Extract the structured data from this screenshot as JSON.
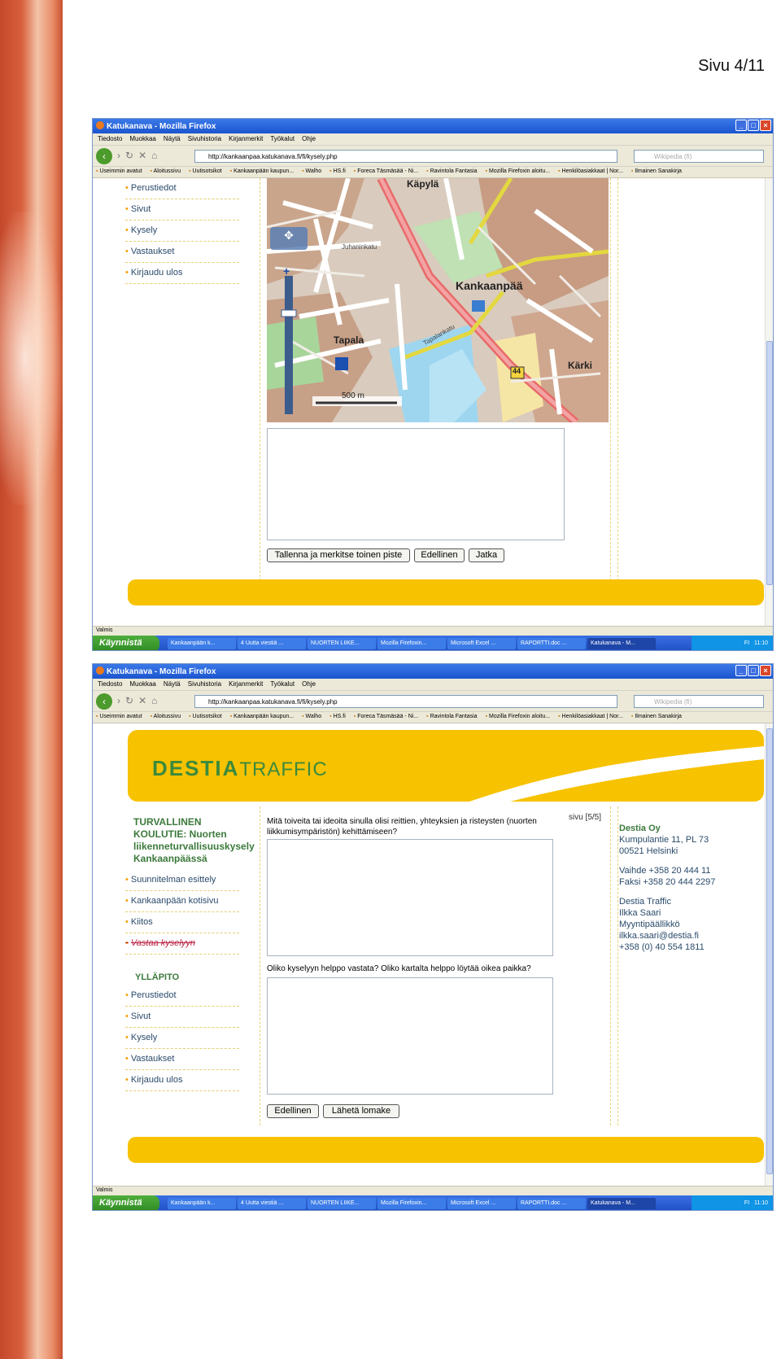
{
  "page": {
    "number_label": "Sivu 4/11"
  },
  "browser": {
    "title": "Katukanava - Mozilla Firefox",
    "menu": [
      "Tiedosto",
      "Muokkaa",
      "Näytä",
      "Sivuhistoria",
      "Kirjanmerkit",
      "Työkalut",
      "Ohje"
    ],
    "url": "http://kankaanpaa.katukanava.fi/fi/kysely.php",
    "search_placeholder": "Wikipedia (fi)",
    "bookmarks": [
      "Useimmin avatut",
      "Aloitussivu",
      "Uutisotsikot",
      "Kankaanpään kaupun...",
      "Walho",
      "HS.fi",
      "Foreca Täsmäsää - Ni...",
      "Ravintola Fantasia",
      "Mozilla Firefoxin aloitu...",
      "Henkilöasiakkaat | Nor...",
      "Ilmainen Sanakirja"
    ],
    "status": "Valmis"
  },
  "taskbar": {
    "start": "Käynnistä",
    "tasks": [
      "Kankaanpään k...",
      "4 Uutta viestiä ...",
      "NUORTEN LIIKE...",
      "Mozilla Firefoxin...",
      "Microsoft Excel ...",
      "RAPORTTI.doc ...",
      "Katukanava - M..."
    ],
    "lang": "FI",
    "time": "11:10"
  },
  "shot1": {
    "nav": [
      "Perustiedot",
      "Sivut",
      "Kysely",
      "Vastaukset",
      "Kirjaudu ulos"
    ],
    "map_labels": {
      "kapyla": "Käpylä",
      "kankaanpaa": "Kankaanpää",
      "tapala": "Tapala",
      "karki": "Kärki",
      "scale": "500 m",
      "road44": "44",
      "juhanin": "Juhaninkatu",
      "tapalan": "Tapalankatu"
    },
    "buttons": {
      "save_another": "Tallenna ja merkitse toinen piste",
      "previous": "Edellinen",
      "continue": "Jatka"
    }
  },
  "shot2": {
    "logo_bold": "DESTIA",
    "logo_light": "TRAFFIC",
    "survey_title": "TURVALLINEN KOULUTIE: Nuorten liikenneturvallisuuskysely Kankaanpäässä",
    "nav_main": [
      "Suunnitelman esittely",
      "Kankaanpään kotisivu",
      "Kiitos",
      "Vastaa kyselyyn"
    ],
    "admin_heading": "YLLÄPITO",
    "nav_admin": [
      "Perustiedot",
      "Sivut",
      "Kysely",
      "Vastaukset",
      "Kirjaudu ulos"
    ],
    "page_indicator": "sivu [5/5]",
    "question1": "Mitä toiveita tai ideoita sinulla olisi reittien, yhteyksien ja risteysten (nuorten liikkumisympäristön) kehittämiseen?",
    "question2": "Oliko kyselyyn helppo vastata? Oliko kartalta helppo löytää oikea paikka?",
    "buttons": {
      "previous": "Edellinen",
      "submit": "Lähetä lomake"
    },
    "contact": {
      "company": "Destia Oy",
      "address1": "Kumpulantie 11, PL 73",
      "address2": "00521 Helsinki",
      "switchboard": "Vaihde +358 20 444 11",
      "fax": "Faksi +358 20 444 2297",
      "unit": "Destia Traffic",
      "name": "Ilkka Saari",
      "role": "Myyntipäällikkö",
      "email": "ilkka.saari@destia.fi",
      "phone": "+358 (0) 40 554 1811"
    }
  },
  "colors": {
    "brand_yellow": "#f7c200",
    "logo_green": "#3c8a3c",
    "nav_text": "#2a4a6a"
  }
}
